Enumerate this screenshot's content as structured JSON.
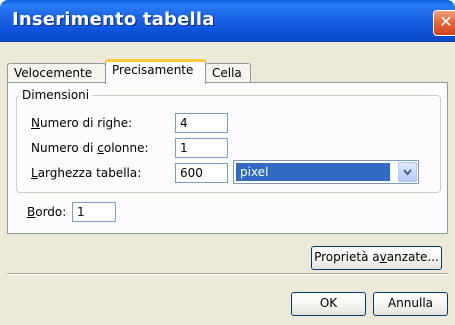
{
  "window": {
    "title": "Inserimento tabella",
    "close_glyph": "✕"
  },
  "tabs": [
    {
      "label": "Velocemente",
      "active": false
    },
    {
      "label": "Precisamente",
      "active": true
    },
    {
      "label": "Cella",
      "active": false
    }
  ],
  "dimensions": {
    "legend": "Dimensioni",
    "rows": {
      "label_mnemonic": "N",
      "label_rest": "umero di righe:",
      "value": "4"
    },
    "columns": {
      "label_before": "Numero di ",
      "label_mnemonic": "c",
      "label_rest": "olonne:",
      "value": "1"
    },
    "table_width": {
      "label_mnemonic": "L",
      "label_rest": "arghezza tabella:",
      "value": "600",
      "unit_selected": "pixel"
    }
  },
  "border": {
    "label_mnemonic": "B",
    "label_rest": "ordo:",
    "value": "1"
  },
  "buttons": {
    "advanced_before": "Proprietà a",
    "advanced_mnemonic": "v",
    "advanced_rest": "anzate...",
    "ok": "OK",
    "cancel": "Annulla"
  },
  "colors": {
    "titlebar": "#0b4fd6",
    "selection": "#316ac5",
    "dialog_bg": "#ece9d8",
    "active_tab_accent": "#ffc83c"
  }
}
